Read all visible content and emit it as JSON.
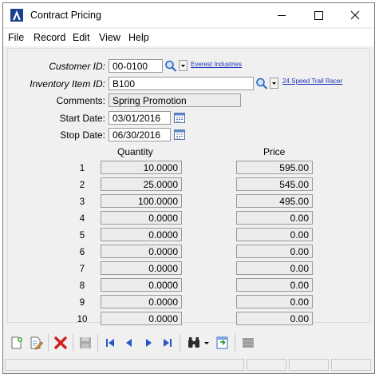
{
  "window": {
    "title": "Contract Pricing"
  },
  "menu": {
    "items": [
      "File",
      "Record",
      "Edit",
      "View",
      "Help"
    ]
  },
  "form": {
    "customer_id_label": "Customer ID:",
    "customer_id_value": "00-0100",
    "customer_name": "Everest Industries",
    "item_label": "Inventory Item ID:",
    "item_value": "B100",
    "item_description": "24 Speed Trail Racer",
    "comments_label": "Comments:",
    "comments_value": "Spring Promotion",
    "start_label": "Start Date:",
    "start_value": "03/01/2016",
    "stop_label": "Stop Date:",
    "stop_value": "06/30/2016"
  },
  "grid": {
    "quantity_header": "Quantity",
    "price_header": "Price",
    "rows": [
      {
        "num": "1",
        "qty": "10.0000",
        "price": "595.00"
      },
      {
        "num": "2",
        "qty": "25.0000",
        "price": "545.00"
      },
      {
        "num": "3",
        "qty": "100.0000",
        "price": "495.00"
      },
      {
        "num": "4",
        "qty": "0.0000",
        "price": "0.00"
      },
      {
        "num": "5",
        "qty": "0.0000",
        "price": "0.00"
      },
      {
        "num": "6",
        "qty": "0.0000",
        "price": "0.00"
      },
      {
        "num": "7",
        "qty": "0.0000",
        "price": "0.00"
      },
      {
        "num": "8",
        "qty": "0.0000",
        "price": "0.00"
      },
      {
        "num": "9",
        "qty": "0.0000",
        "price": "0.00"
      },
      {
        "num": "10",
        "qty": "0.0000",
        "price": "0.00"
      }
    ]
  },
  "icons": {
    "app": "app-logo-icon",
    "toolbar": [
      "new-record-icon",
      "edit-record-icon",
      "delete-icon",
      "save-icon",
      "first-record-icon",
      "previous-record-icon",
      "next-record-icon",
      "last-record-icon",
      "find-icon",
      "find-dropdown-icon",
      "export-icon",
      "disabled-icon"
    ]
  },
  "colors": {
    "link": "#1a32b9",
    "delete_red": "#d0201c",
    "nav_blue": "#2456c8"
  }
}
